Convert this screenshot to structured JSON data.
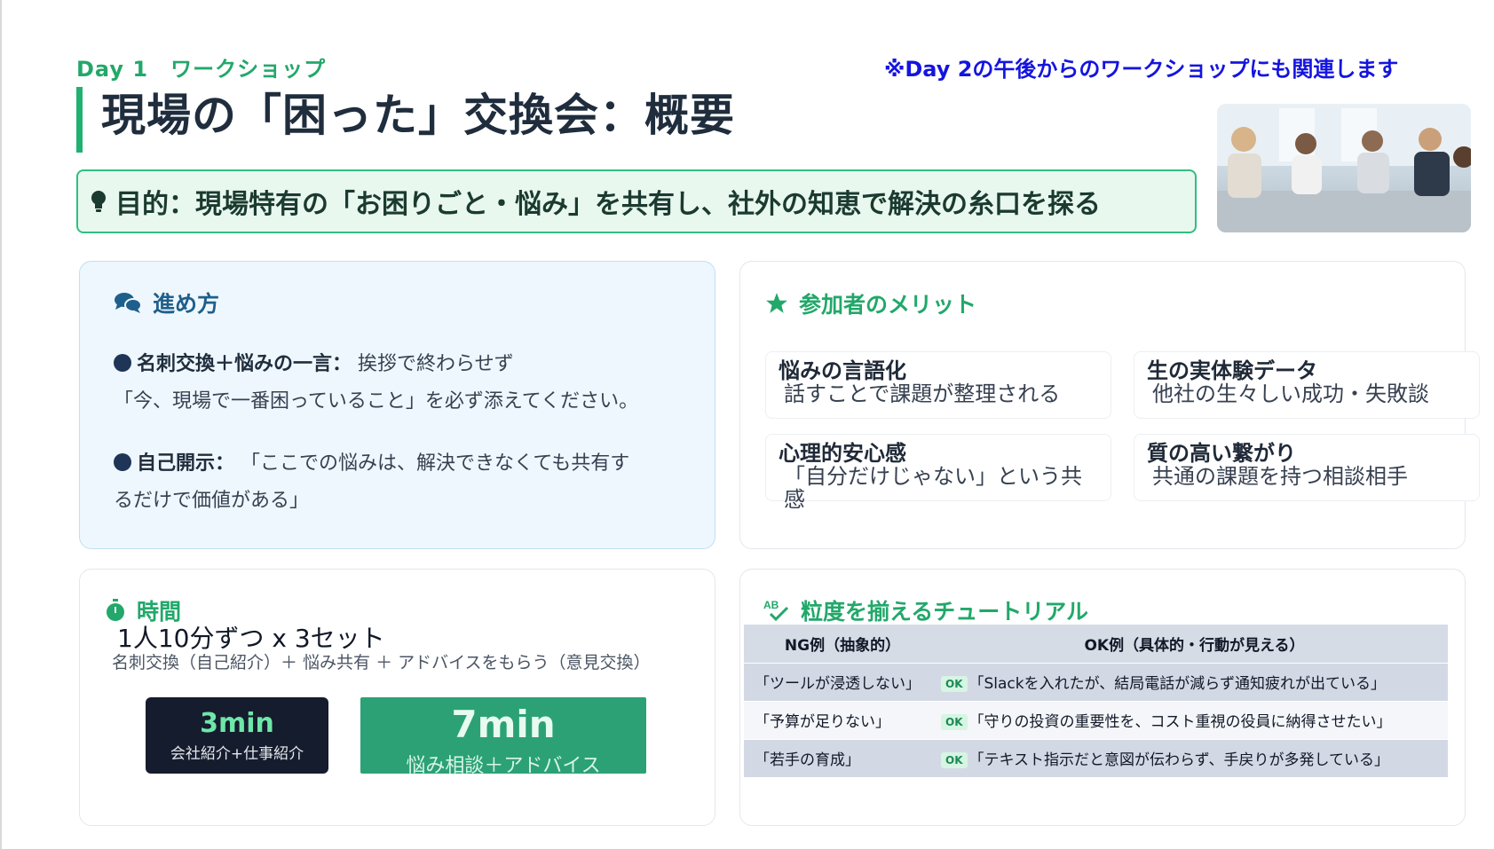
{
  "header": {
    "day_label": "Day 1　ワークショップ",
    "note": "※Day 2の午後からのワークショップにも関連します",
    "title": "現場の「困った」交換会：概要"
  },
  "purpose": {
    "icon": "lightbulb-icon",
    "text": "目的：現場特有の「お困りごと・悩み」を共有し、社外の知恵で解決の糸口を探る"
  },
  "photo": {
    "icon": "meeting-photo"
  },
  "process": {
    "heading": "進め方",
    "icon": "comments-icon",
    "items": [
      {
        "label": "名刺交換＋悩みの一言：",
        "text": "挨拶で終わらせず",
        "text2": "「今、現場で一番困っていること」を必ず添えてください。"
      },
      {
        "label": "自己開示：",
        "text": "「ここでの悩みは、解決できなくても共有す",
        "text2": "るだけで価値がある」"
      }
    ]
  },
  "merits": {
    "heading": "参加者のメリット",
    "icon": "star-icon",
    "items": [
      {
        "title": "悩みの言語化",
        "desc": "話すことで課題が整理される"
      },
      {
        "title": "生の実体験データ",
        "desc": "他社の生々しい成功・失敗談"
      },
      {
        "title": "心理的安心感",
        "desc": "「自分だけじゃない」という共感"
      },
      {
        "title": "質の高い繋がり",
        "desc": "共通の課題を持つ相談相手"
      }
    ]
  },
  "time": {
    "heading": "時間",
    "icon": "stopwatch-icon",
    "main": "1人10分ずつ x 3セット",
    "sub": "名刺交換（自己紹介）＋ 悩み共有 ＋ アドバイスをもらう（意見交換）",
    "block1": {
      "duration": "3min",
      "label": "会社紹介+仕事紹介"
    },
    "block2": {
      "duration": "7min",
      "label": "悩み相談＋アドバイス"
    }
  },
  "tutorial": {
    "heading": "粒度を揃えるチュートリアル",
    "icon": "spellcheck-icon",
    "col_ng": "NG例（抽象的）",
    "col_ok": "OK例（具体的・行動が見える）",
    "ok_badge": "OK",
    "rows": [
      {
        "ng": "「ツールが浸透しない」",
        "ok": "「Slackを入れたが、結局電話が減らず通知疲れが出ている」"
      },
      {
        "ng": "「予算が足りない」",
        "ok": "「守りの投資の重要性を、コスト重視の役員に納得させたい」"
      },
      {
        "ng": "「若手の育成」",
        "ok": "「テキスト指示だと意図が伝わらず、手戻りが多発している」"
      }
    ]
  },
  "colors": {
    "green": "#22a86a",
    "blue_note": "#1414e0",
    "navy": "#151c2e",
    "teal_block": "#2ca176"
  }
}
